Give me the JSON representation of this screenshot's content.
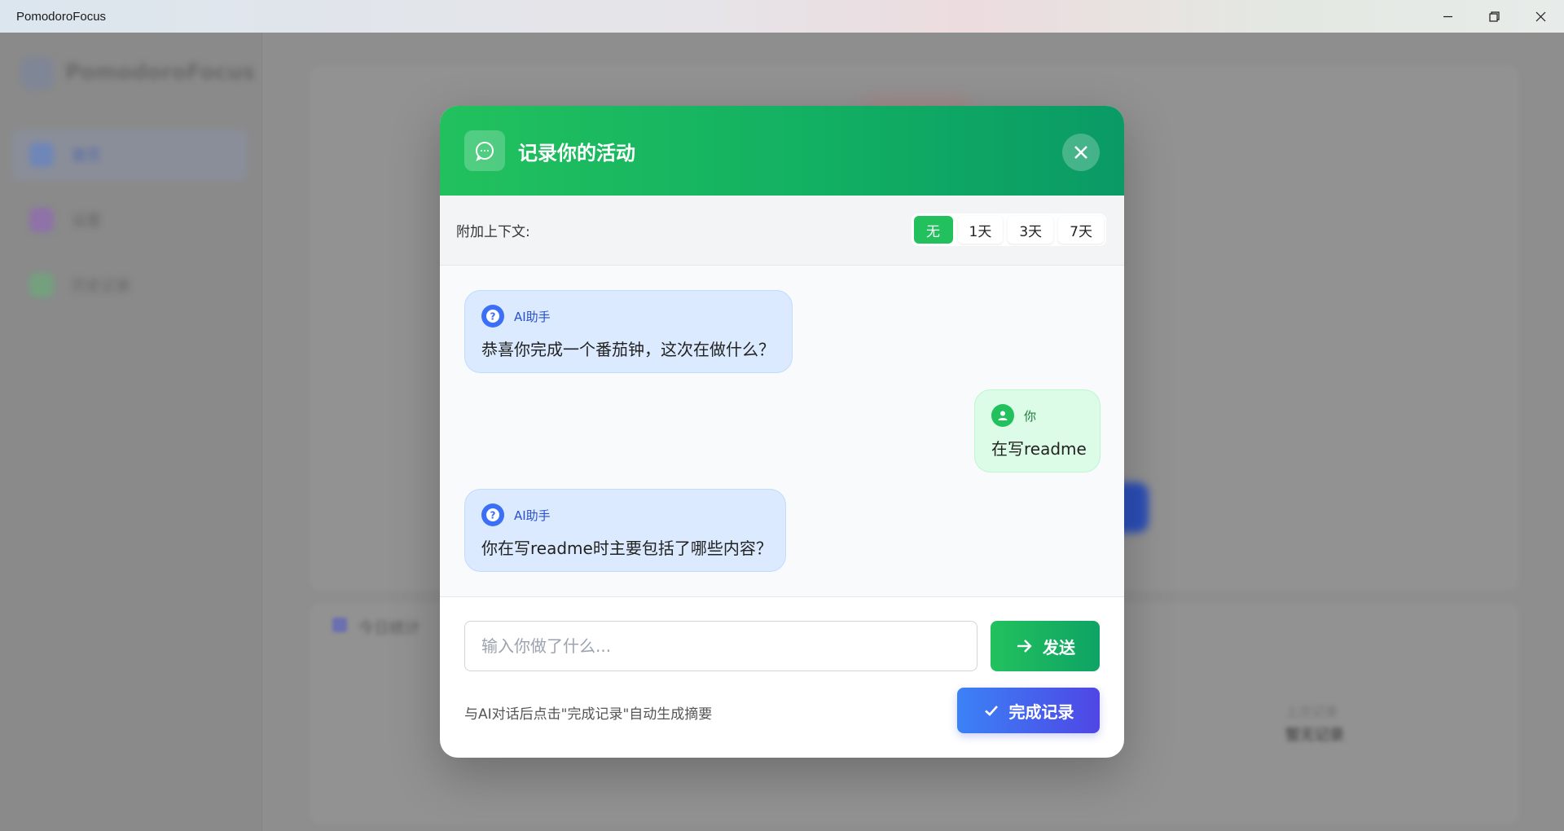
{
  "window": {
    "title": "PomodoroFocus",
    "controls": [
      "minimize-icon",
      "restore-icon",
      "close-icon"
    ]
  },
  "background_app": {
    "logo_text": "PomodoroFocus",
    "nav": [
      "首页",
      "设置",
      "历史记录"
    ],
    "stats_title": "今日统计",
    "stats_label": "上次记录",
    "stats_value": "暂无记录"
  },
  "dialog": {
    "title": "记录你的活动",
    "header_icon": "chat-bubble-icon",
    "close_icon": "close-icon",
    "context": {
      "label": "附加上下文:",
      "options": [
        "无",
        "1天",
        "3天",
        "7天"
      ],
      "selected": "无"
    },
    "messages": [
      {
        "role": "ai",
        "sender": "AI助手",
        "text": "恭喜你完成一个番茄钟，这次在做什么？"
      },
      {
        "role": "user",
        "sender": "你",
        "text": "在写readme"
      },
      {
        "role": "ai",
        "sender": "AI助手",
        "text": "你在写readme时主要包括了哪些内容？"
      }
    ],
    "input": {
      "placeholder": "输入你做了什么...",
      "value": ""
    },
    "send_label": "发送",
    "hint": "与AI对话后点击\"完成记录\"自动生成摘要",
    "finish_label": "完成记录"
  },
  "colors": {
    "header_green": "#22c15e",
    "ai_bubble": "#dbeafe",
    "user_bubble": "#dcfce7",
    "finish_blue": "#3b82f6"
  }
}
